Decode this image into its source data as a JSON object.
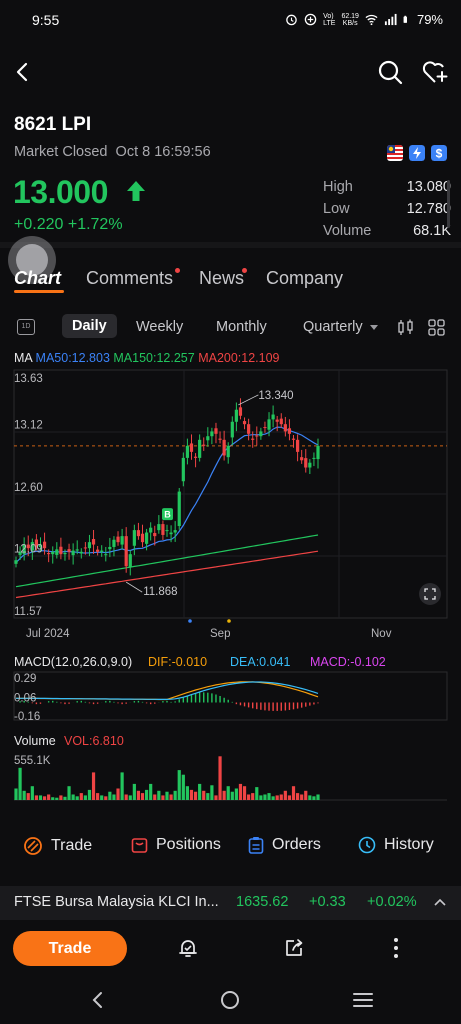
{
  "status_bar": {
    "time": "9:55",
    "net_speed_top": "62.19",
    "net_speed_bottom": "KB/s",
    "battery": "79%"
  },
  "stock": {
    "code": "8621",
    "name": "LPI",
    "market_status": "Market Closed",
    "datetime": "Oct 8 16:59:56",
    "price": "13.000",
    "change": "+0.220",
    "change_pct": "+1.72%",
    "stats": [
      {
        "label": "High",
        "value": "13.080"
      },
      {
        "label": "Low",
        "value": "12.780"
      },
      {
        "label": "Volume",
        "value": "68.1K"
      }
    ]
  },
  "tabs": [
    {
      "label": "Chart",
      "active": true,
      "dot": false
    },
    {
      "label": "Comments",
      "active": false,
      "dot": true
    },
    {
      "label": "News",
      "active": false,
      "dot": true
    },
    {
      "label": "Company",
      "active": false,
      "dot": false
    }
  ],
  "periods": {
    "icon_1d": "1D",
    "items": [
      "Daily",
      "Weekly",
      "Monthly",
      "Quarterly"
    ],
    "active": "Daily"
  },
  "ma_legend": {
    "label": "MA",
    "ma50": "MA50:12.803",
    "ma150": "MA150:12.257",
    "ma200": "MA200:12.109"
  },
  "colors": {
    "up": "#22c55e",
    "down": "#ef4444",
    "ma50": "#3b82f6",
    "ma150": "#22c55e",
    "ma200": "#ef4444",
    "accent": "#f97316",
    "dif": "#f59e0b",
    "dea": "#38bdf8",
    "macd": "#d946ef"
  },
  "chart_data": [
    {
      "type": "candlestick",
      "yticks": [
        "13.63",
        "13.12",
        "12.60",
        "12.09",
        "11.57"
      ],
      "ylim": [
        11.57,
        13.63
      ],
      "xticks": [
        "Jul 2024",
        "Sep",
        "Nov"
      ],
      "annotations": [
        {
          "text": "13.340",
          "value": 13.34
        },
        {
          "text": "11.868",
          "value": 11.868
        }
      ],
      "last_price_line": 13.0,
      "buy_marker": "B",
      "closes": [
        12.05,
        12.12,
        12.18,
        12.15,
        12.2,
        12.16,
        12.18,
        12.15,
        12.1,
        12.12,
        12.14,
        12.1,
        12.11,
        12.12,
        12.13,
        12.14,
        12.12,
        12.15,
        12.2,
        12.18,
        12.12,
        12.13,
        12.1,
        12.16,
        12.22,
        12.2,
        12.25,
        12.0,
        12.1,
        12.3,
        12.25,
        12.2,
        12.28,
        12.32,
        12.25,
        12.35,
        12.26,
        12.3,
        12.28,
        12.3,
        12.62,
        12.9,
        13.0,
        12.95,
        12.9,
        13.05,
        13.0,
        13.08,
        13.12,
        13.1,
        13.05,
        12.92,
        13.0,
        13.2,
        13.3,
        13.25,
        13.18,
        13.1,
        13.05,
        13.08,
        13.12,
        13.15,
        13.22,
        13.26,
        13.2,
        13.18,
        13.12,
        13.1,
        13.05,
        12.95,
        12.88,
        12.82,
        12.86,
        12.9,
        13.0
      ]
    },
    {
      "type": "line",
      "name": "MACD",
      "title": "MACD(12.0,26.0,9.0)",
      "dif": "DIF:-0.010",
      "dea": "DEA:0.041",
      "macd": "MACD:-0.102",
      "yticks": [
        "0.29",
        "0.06",
        "-0.16"
      ]
    },
    {
      "type": "bar",
      "name": "Volume",
      "title": "Volume",
      "vol": "VOL:6.810",
      "ytick": "555.1K"
    }
  ],
  "trade_bar": [
    {
      "icon": "trade-icon",
      "label": "Trade"
    },
    {
      "icon": "positions-icon",
      "label": "Positions"
    },
    {
      "icon": "orders-icon",
      "label": "Orders"
    },
    {
      "icon": "history-icon",
      "label": "History"
    }
  ],
  "index_bar": {
    "name": "FTSE Bursa Malaysia KLCI In...",
    "value": "1635.62",
    "change": "+0.33",
    "change_pct": "+0.02%"
  },
  "actions": {
    "trade_button": "Trade"
  }
}
